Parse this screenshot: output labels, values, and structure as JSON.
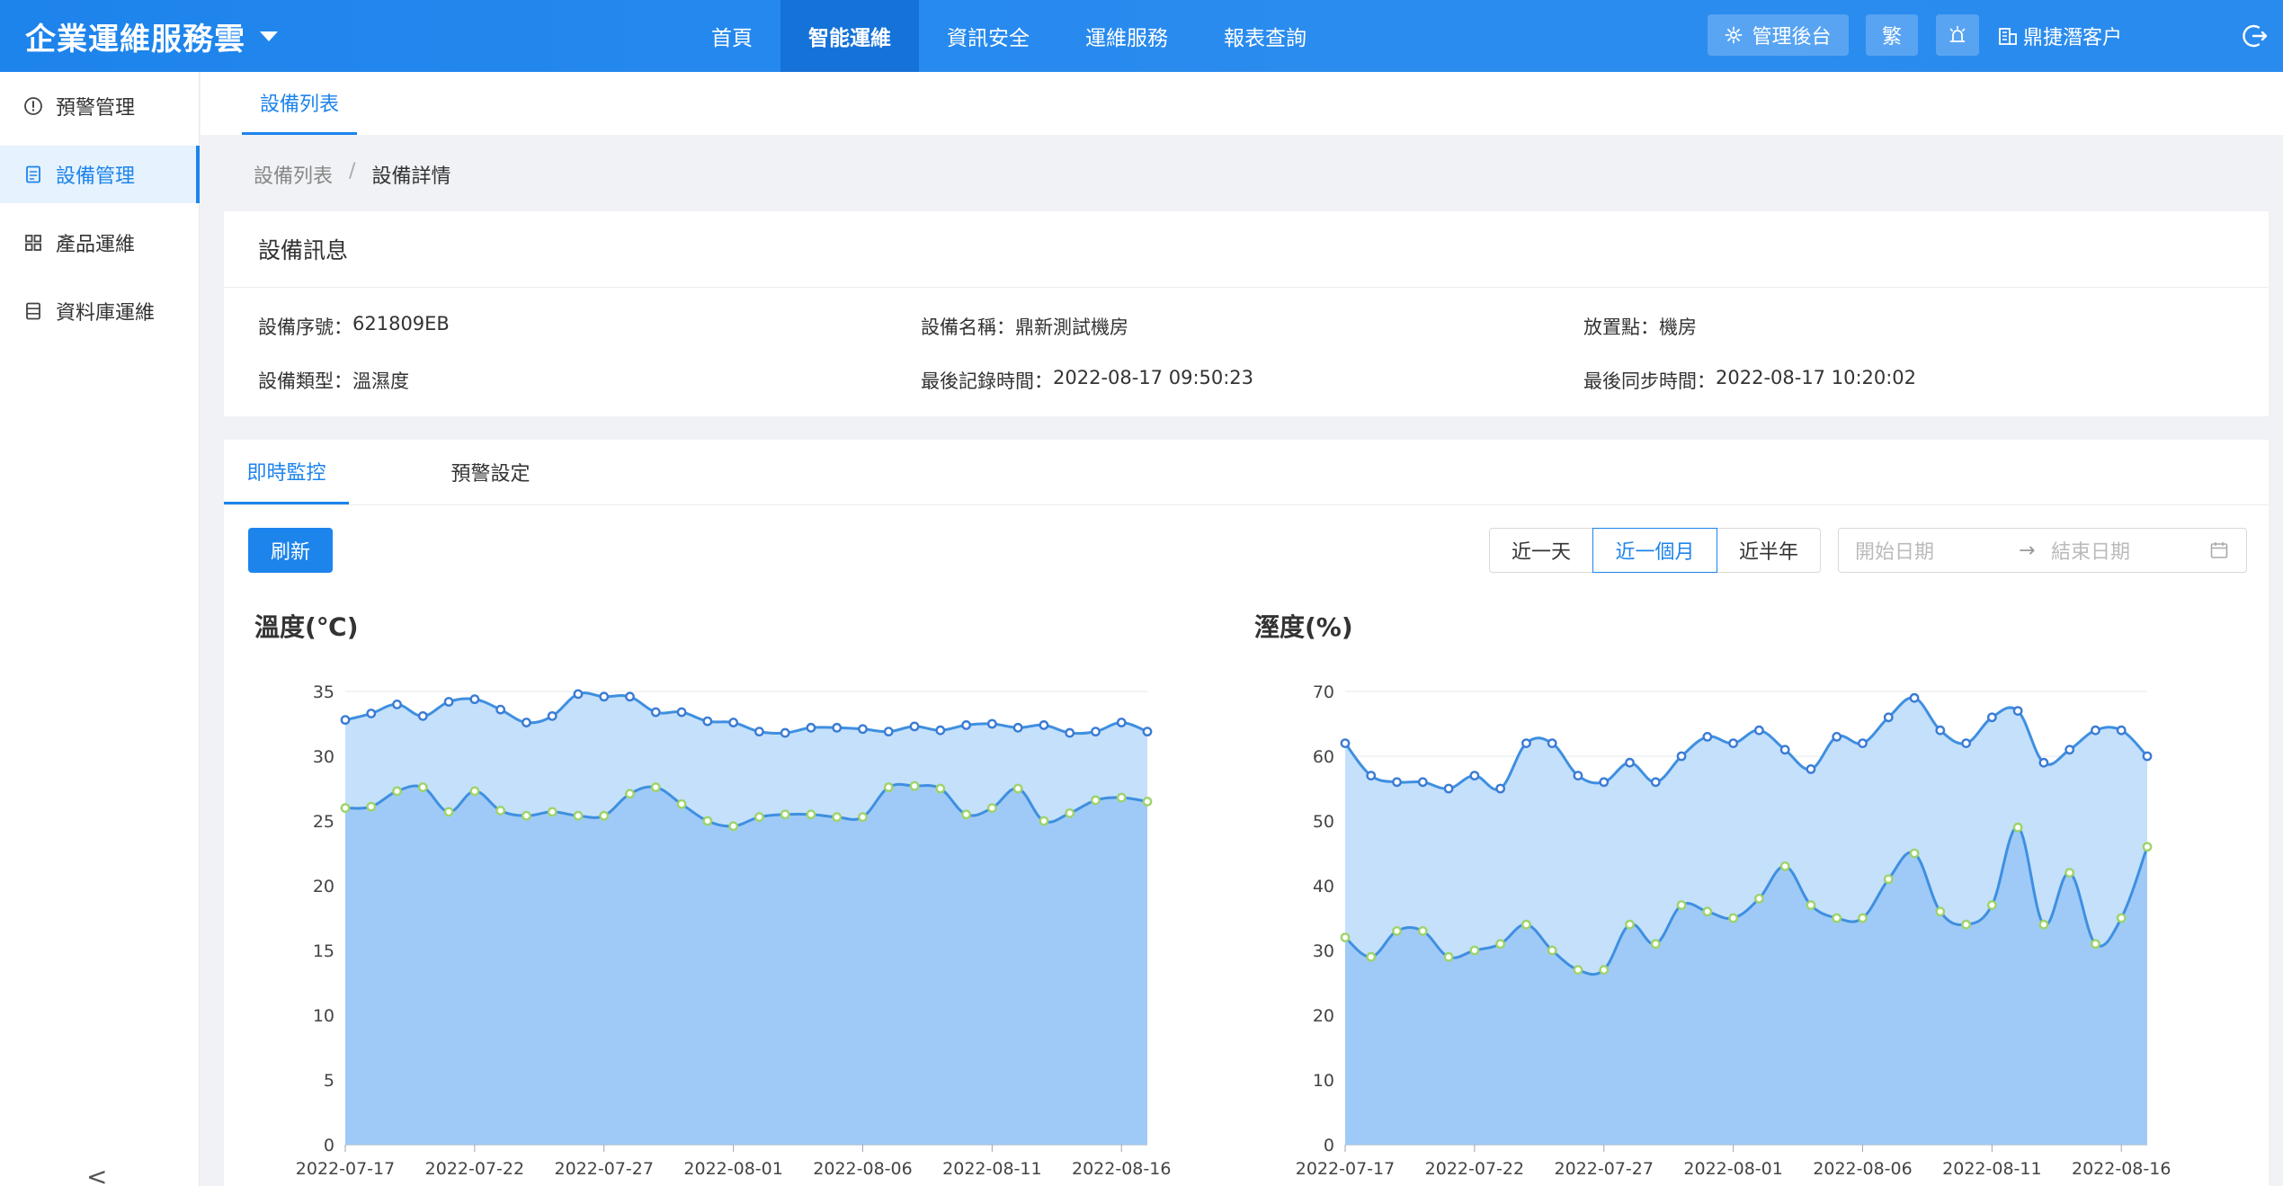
{
  "header": {
    "brand": "企業運維服務雲",
    "nav": [
      "首頁",
      "智能運維",
      "資訊安全",
      "運維服務",
      "報表查詢"
    ],
    "active_nav": 1,
    "admin_label": "管理後台",
    "lang_label": "繁",
    "customer": "鼎捷潛客户"
  },
  "sidebar": {
    "items": [
      {
        "label": "預警管理",
        "icon": "alert-circle-icon"
      },
      {
        "label": "設備管理",
        "icon": "device-list-icon"
      },
      {
        "label": "產品運維",
        "icon": "grid-icon"
      },
      {
        "label": "資料庫運維",
        "icon": "database-icon"
      }
    ],
    "active": 1,
    "collapse_glyph": "<"
  },
  "page_tab": "設備列表",
  "breadcrumb": {
    "parent": "設備列表",
    "separator": "/",
    "current": "設備詳情"
  },
  "device_info": {
    "title": "設備訊息",
    "fields": [
      {
        "label": "設備序號：",
        "value": "621809EB"
      },
      {
        "label": "設備名稱：",
        "value": "鼎新測試機房"
      },
      {
        "label": "放置點：",
        "value": "機房"
      },
      {
        "label": "設備類型：",
        "value": "溫濕度"
      },
      {
        "label": "最後記錄時間：",
        "value": "2022-08-17 09:50:23"
      },
      {
        "label": "最後同步時間：",
        "value": "2022-08-17 10:20:02"
      }
    ]
  },
  "monitor": {
    "tabs": [
      "即時監控",
      "預警設定"
    ],
    "active_tab": 0,
    "refresh_label": "刷新",
    "ranges": [
      "近一天",
      "近一個月",
      "近半年"
    ],
    "active_range": 1,
    "start_placeholder": "開始日期",
    "range_arrow": "→",
    "end_placeholder": "結束日期"
  },
  "chart_data": [
    {
      "type": "area",
      "title": "溫度(℃)",
      "x": [
        "2022-07-17",
        "2022-07-18",
        "2022-07-19",
        "2022-07-20",
        "2022-07-21",
        "2022-07-22",
        "2022-07-23",
        "2022-07-24",
        "2022-07-25",
        "2022-07-26",
        "2022-07-27",
        "2022-07-28",
        "2022-07-29",
        "2022-07-30",
        "2022-07-31",
        "2022-08-01",
        "2022-08-02",
        "2022-08-03",
        "2022-08-04",
        "2022-08-05",
        "2022-08-06",
        "2022-08-07",
        "2022-08-08",
        "2022-08-09",
        "2022-08-10",
        "2022-08-11",
        "2022-08-12",
        "2022-08-13",
        "2022-08-14",
        "2022-08-15",
        "2022-08-16",
        "2022-08-17"
      ],
      "x_ticks": [
        "2022-07-17",
        "2022-07-22",
        "2022-07-27",
        "2022-08-01",
        "2022-08-06",
        "2022-08-11",
        "2022-08-16"
      ],
      "ylim": [
        0,
        35
      ],
      "y_ticks": [
        0,
        5,
        10,
        15,
        20,
        25,
        30,
        35
      ],
      "series": [
        {
          "color": "#3a7bd5",
          "values": [
            32.8,
            33.3,
            34.0,
            33.1,
            34.2,
            34.4,
            33.6,
            32.6,
            33.1,
            34.8,
            34.6,
            34.6,
            33.4,
            33.4,
            32.7,
            32.6,
            31.9,
            31.8,
            32.2,
            32.2,
            32.1,
            31.9,
            32.3,
            32.0,
            32.4,
            32.5,
            32.2,
            32.4,
            31.8,
            31.9,
            32.6,
            31.9
          ]
        },
        {
          "color": "#9ed36a",
          "values": [
            26.0,
            26.1,
            27.3,
            27.6,
            25.7,
            27.3,
            25.8,
            25.4,
            25.7,
            25.4,
            25.4,
            27.1,
            27.6,
            26.3,
            25.0,
            24.6,
            25.3,
            25.5,
            25.5,
            25.3,
            25.3,
            27.6,
            27.7,
            27.5,
            25.5,
            26.0,
            27.5,
            25.0,
            25.6,
            26.6,
            26.8,
            26.5
          ]
        }
      ],
      "grid": true
    },
    {
      "type": "area",
      "title": "溼度(%)",
      "x": [
        "2022-07-17",
        "2022-07-18",
        "2022-07-19",
        "2022-07-20",
        "2022-07-21",
        "2022-07-22",
        "2022-07-23",
        "2022-07-24",
        "2022-07-25",
        "2022-07-26",
        "2022-07-27",
        "2022-07-28",
        "2022-07-29",
        "2022-07-30",
        "2022-07-31",
        "2022-08-01",
        "2022-08-02",
        "2022-08-03",
        "2022-08-04",
        "2022-08-05",
        "2022-08-06",
        "2022-08-07",
        "2022-08-08",
        "2022-08-09",
        "2022-08-10",
        "2022-08-11",
        "2022-08-12",
        "2022-08-13",
        "2022-08-14",
        "2022-08-15",
        "2022-08-16",
        "2022-08-17"
      ],
      "x_ticks": [
        "2022-07-17",
        "2022-07-22",
        "2022-07-27",
        "2022-08-01",
        "2022-08-06",
        "2022-08-11",
        "2022-08-16"
      ],
      "ylim": [
        0,
        70
      ],
      "y_ticks": [
        0,
        10,
        20,
        30,
        40,
        50,
        60,
        70
      ],
      "series": [
        {
          "color": "#3a7bd5",
          "values": [
            62,
            57,
            56,
            56,
            55,
            57,
            55,
            62,
            62,
            57,
            56,
            59,
            56,
            60,
            63,
            62,
            64,
            61,
            58,
            63,
            62,
            66,
            69,
            64,
            62,
            66,
            67,
            59,
            61,
            64,
            64,
            60
          ]
        },
        {
          "color": "#9ed36a",
          "values": [
            32,
            29,
            33,
            33,
            29,
            30,
            31,
            34,
            30,
            27,
            27,
            34,
            31,
            37,
            36,
            35,
            38,
            43,
            37,
            35,
            35,
            41,
            45,
            36,
            34,
            37,
            49,
            34,
            42,
            31,
            35,
            46
          ]
        }
      ],
      "grid": true
    }
  ]
}
